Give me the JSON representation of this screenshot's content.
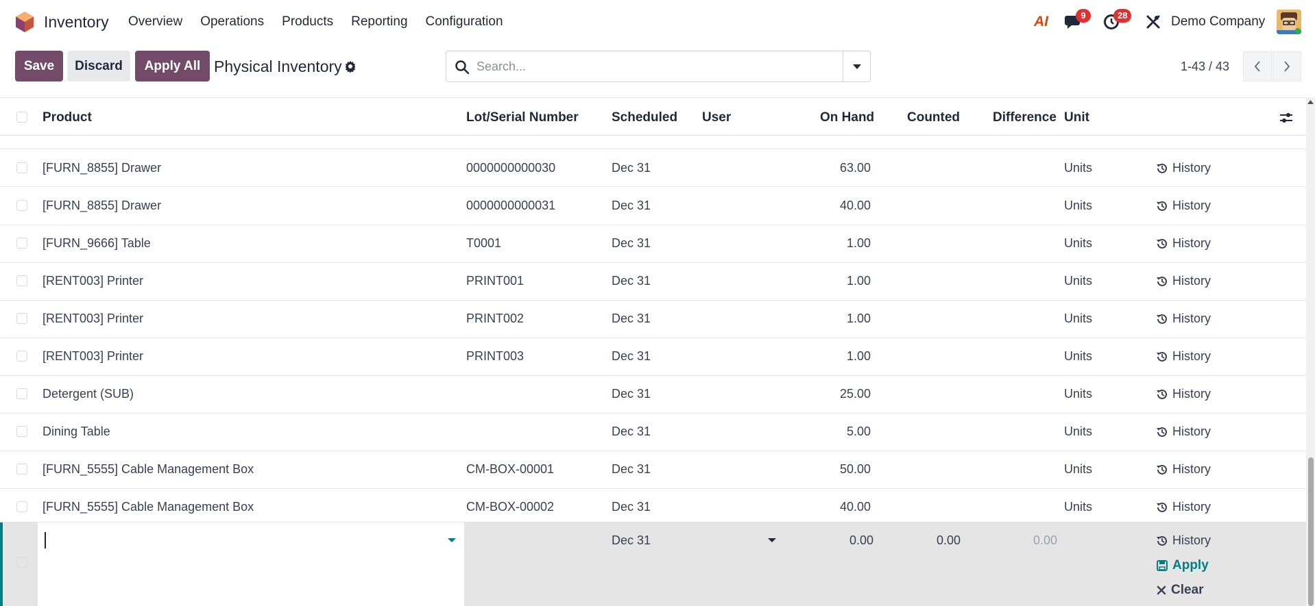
{
  "navbar": {
    "app_name": "Inventory",
    "menu": [
      "Overview",
      "Operations",
      "Products",
      "Reporting",
      "Configuration"
    ],
    "ai_label": "AI",
    "messages_badge": "9",
    "activities_badge": "28",
    "company": "Demo Company"
  },
  "control": {
    "save": "Save",
    "discard": "Discard",
    "apply_all": "Apply All",
    "title": "Physical Inventory",
    "search_placeholder": "Search...",
    "pager": "1-43 / 43"
  },
  "table": {
    "columns": {
      "product": "Product",
      "lot": "Lot/Serial Number",
      "scheduled": "Scheduled",
      "user": "User",
      "on_hand": "On Hand",
      "counted": "Counted",
      "difference": "Difference",
      "unit": "Unit"
    },
    "rows": [
      {
        "product": "[FURN_8855] Drawer",
        "lot": "0000000000030",
        "scheduled": "Dec 31",
        "on_hand": "63.00",
        "unit": "Units",
        "action": "History"
      },
      {
        "product": "[FURN_8855] Drawer",
        "lot": "0000000000031",
        "scheduled": "Dec 31",
        "on_hand": "40.00",
        "unit": "Units",
        "action": "History"
      },
      {
        "product": "[FURN_9666] Table",
        "lot": "T0001",
        "scheduled": "Dec 31",
        "on_hand": "1.00",
        "unit": "Units",
        "action": "History"
      },
      {
        "product": "[RENT003] Printer",
        "lot": "PRINT001",
        "scheduled": "Dec 31",
        "on_hand": "1.00",
        "unit": "Units",
        "action": "History"
      },
      {
        "product": "[RENT003] Printer",
        "lot": "PRINT002",
        "scheduled": "Dec 31",
        "on_hand": "1.00",
        "unit": "Units",
        "action": "History"
      },
      {
        "product": "[RENT003] Printer",
        "lot": "PRINT003",
        "scheduled": "Dec 31",
        "on_hand": "1.00",
        "unit": "Units",
        "action": "History"
      },
      {
        "product": "Detergent (SUB)",
        "lot": "",
        "scheduled": "Dec 31",
        "on_hand": "25.00",
        "unit": "Units",
        "action": "History"
      },
      {
        "product": "Dining Table",
        "lot": "",
        "scheduled": "Dec 31",
        "on_hand": "5.00",
        "unit": "Units",
        "action": "History"
      },
      {
        "product": "[FURN_5555] Cable Management Box",
        "lot": "CM-BOX-00001",
        "scheduled": "Dec 31",
        "on_hand": "50.00",
        "unit": "Units",
        "action": "History"
      },
      {
        "product": "[FURN_5555] Cable Management Box",
        "lot": "CM-BOX-00002",
        "scheduled": "Dec 31",
        "on_hand": "40.00",
        "unit": "Units",
        "action": "History"
      }
    ],
    "edit_row": {
      "scheduled": "Dec 31",
      "on_hand": "0.00",
      "counted": "0.00",
      "difference": "0.00",
      "history": "History",
      "apply": "Apply",
      "clear": "Clear"
    }
  },
  "colors": {
    "primary": "#714b67",
    "accent": "#017e84",
    "badge": "#e03131"
  }
}
